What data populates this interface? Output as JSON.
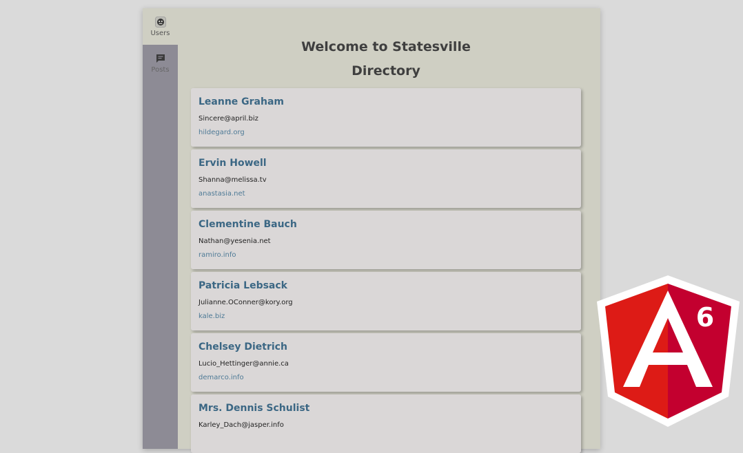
{
  "nav": {
    "items": [
      {
        "label": "Users",
        "icon": "users-icon",
        "active": true
      },
      {
        "label": "Posts",
        "icon": "chat-icon",
        "active": false
      }
    ]
  },
  "page": {
    "title_line1": "Welcome to Statesville",
    "title_line2": "Directory"
  },
  "users": [
    {
      "name": "Leanne Graham",
      "email": "Sincere@april.biz",
      "website": "hildegard.org"
    },
    {
      "name": "Ervin Howell",
      "email": "Shanna@melissa.tv",
      "website": "anastasia.net"
    },
    {
      "name": "Clementine Bauch",
      "email": "Nathan@yesenia.net",
      "website": "ramiro.info"
    },
    {
      "name": "Patricia Lebsack",
      "email": "Julianne.OConner@kory.org",
      "website": "kale.biz"
    },
    {
      "name": "Chelsey Dietrich",
      "email": "Lucio_Hettinger@annie.ca",
      "website": "demarco.info"
    },
    {
      "name": "Mrs. Dennis Schulist",
      "email": "Karley_Dach@jasper.info",
      "website": ""
    }
  ],
  "badge": {
    "logo": "angular-logo",
    "version": "6",
    "colors": {
      "left": "#dd1b16",
      "right": "#c3002f",
      "border": "#ffffff"
    }
  }
}
